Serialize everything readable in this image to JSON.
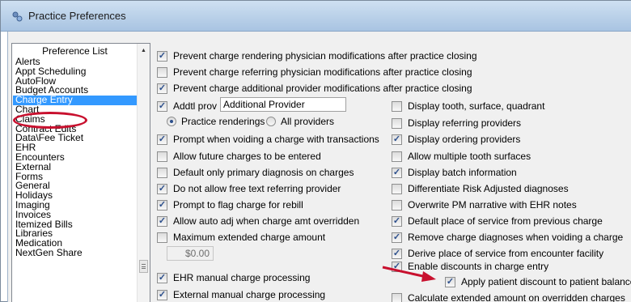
{
  "window": {
    "title": "Practice Preferences",
    "accent": "#3399ff",
    "highlight": "#c8102e"
  },
  "preference_list": {
    "header": "Preference List",
    "items": [
      "Alerts",
      "Appt Scheduling",
      "AutoFlow",
      "Budget Accounts",
      "Charge Entry",
      "Chart",
      "Claims",
      "Contract Edits",
      "Data\\Fee Ticket",
      "EHR",
      "Encounters",
      "External",
      "Forms",
      "General",
      "Holidays",
      "Imaging",
      "Invoices",
      "Itemized Bills",
      "Libraries",
      "Medication",
      "NextGen Share"
    ],
    "selected": "Charge Entry"
  },
  "top_options": [
    {
      "label": "Prevent charge rendering physician modifications after practice closing",
      "checked": true
    },
    {
      "label": "Prevent charge referring physician modifications after practice closing",
      "checked": false
    },
    {
      "label": "Prevent charge additional provider modifications after practice closing",
      "checked": true
    }
  ],
  "addtl_prov": {
    "label": "Addtl prov",
    "checked": true,
    "value": "Additional Provider"
  },
  "radios": {
    "practice": "Practice renderings",
    "all": "All providers",
    "selected": "practice"
  },
  "left_options": [
    {
      "label": "Prompt when voiding a charge with transactions",
      "checked": true
    },
    {
      "label": "Allow future charges to be entered",
      "checked": false
    },
    {
      "label": "Default only primary diagnosis on charges",
      "checked": false
    },
    {
      "label": "Do not allow free text referring provider",
      "checked": true
    },
    {
      "label": "Prompt to flag charge for rebill",
      "checked": true
    },
    {
      "label": "Allow auto adj when charge amt overridden",
      "checked": true
    },
    {
      "label": "Maximum extended charge amount",
      "checked": false
    }
  ],
  "max_amount": "$0.00",
  "bottom_left_options": [
    {
      "label": "EHR manual charge processing",
      "checked": true
    },
    {
      "label": "External manual charge processing",
      "checked": true
    }
  ],
  "right_options": [
    {
      "label": "Display tooth, surface, quadrant",
      "checked": false
    },
    {
      "label": "Display referring providers",
      "checked": false
    },
    {
      "label": "Display ordering providers",
      "checked": true
    },
    {
      "label": "Allow multiple tooth surfaces",
      "checked": false
    },
    {
      "label": "Display batch information",
      "checked": true
    },
    {
      "label": "Differentiate Risk Adjusted diagnoses",
      "checked": false
    },
    {
      "label": "Overwrite PM narrative with EHR notes",
      "checked": false
    },
    {
      "label": "Default place of service from previous charge",
      "checked": true
    },
    {
      "label": "Remove charge diagnoses when voiding a charge",
      "checked": true
    },
    {
      "label": "Derive place of service from encounter facility",
      "checked": true
    },
    {
      "label": "Enable discounts in charge entry",
      "checked": true
    }
  ],
  "sub_option": {
    "label": "Apply patient discount to patient balance only",
    "checked": true
  },
  "last_option": {
    "label": "Calculate extended amount on overridden charges",
    "checked": false
  }
}
